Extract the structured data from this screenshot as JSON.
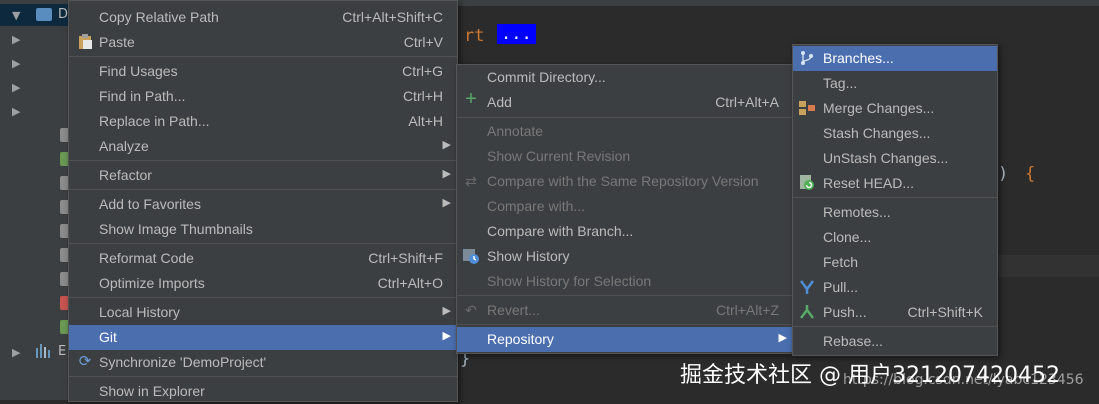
{
  "tree": {
    "root_label": "D",
    "bottom_label": "E"
  },
  "editor": {
    "keyword": "rt",
    "highlight": "...",
    "paren": ")",
    "brace": "{",
    "close_brace": "}"
  },
  "menu1": {
    "items": [
      {
        "label": "Copy Relative Path",
        "shortcut": "Ctrl+Alt+Shift+C"
      },
      {
        "label": "Paste",
        "shortcut": "Ctrl+V",
        "icon": "clipboard-icon"
      },
      {
        "label": "Find Usages",
        "shortcut": "Ctrl+G"
      },
      {
        "label": "Find in Path...",
        "shortcut": "Ctrl+H"
      },
      {
        "label": "Replace in Path...",
        "shortcut": "Alt+H"
      },
      {
        "label": "Analyze",
        "submenu": true
      },
      {
        "label": "Refactor",
        "submenu": true
      },
      {
        "label": "Add to Favorites",
        "submenu": true
      },
      {
        "label": "Show Image Thumbnails"
      },
      {
        "label": "Reformat Code",
        "shortcut": "Ctrl+Shift+F"
      },
      {
        "label": "Optimize Imports",
        "shortcut": "Ctrl+Alt+O"
      },
      {
        "label": "Local History",
        "submenu": true
      },
      {
        "label": "Git",
        "submenu": true,
        "highlighted": true
      },
      {
        "label": "Synchronize 'DemoProject'",
        "icon": "sync-icon"
      },
      {
        "label": "Show in Explorer"
      }
    ]
  },
  "menu2": {
    "items": [
      {
        "label": "Commit Directory..."
      },
      {
        "label": "Add",
        "shortcut": "Ctrl+Alt+A",
        "icon": "plus-icon"
      },
      {
        "label": "Annotate",
        "disabled": true
      },
      {
        "label": "Show Current Revision",
        "disabled": true
      },
      {
        "label": "Compare with the Same Repository Version",
        "disabled": true,
        "icon": "compare-icon"
      },
      {
        "label": "Compare with...",
        "disabled": true
      },
      {
        "label": "Compare with Branch..."
      },
      {
        "label": "Show History",
        "icon": "history-icon"
      },
      {
        "label": "Show History for Selection",
        "disabled": true
      },
      {
        "label": "Revert...",
        "shortcut": "Ctrl+Alt+Z",
        "disabled": true,
        "icon": "revert-icon"
      },
      {
        "label": "Repository",
        "submenu": true,
        "highlighted": true
      }
    ]
  },
  "menu3": {
    "items": [
      {
        "label": "Branches...",
        "highlighted": true,
        "icon": "branch-icon"
      },
      {
        "label": "Tag..."
      },
      {
        "label": "Merge Changes...",
        "icon": "merge-icon"
      },
      {
        "label": "Stash Changes..."
      },
      {
        "label": "UnStash Changes..."
      },
      {
        "label": "Reset HEAD...",
        "icon": "reset-icon"
      },
      {
        "label": "Remotes..."
      },
      {
        "label": "Clone..."
      },
      {
        "label": "Fetch"
      },
      {
        "label": "Pull...",
        "icon": "pull-icon"
      },
      {
        "label": "Push...",
        "shortcut": "Ctrl+Shift+K",
        "icon": "push-icon"
      },
      {
        "label": "Rebase..."
      }
    ]
  },
  "watermark": {
    "main": "掘金技术社区 @ 用户321207420452",
    "url": "https://blog.csdn.net/lyabc123456"
  },
  "colors": {
    "highlight": "#4b6eaf",
    "menu_bg": "#3c3f41",
    "editor_bg": "#2b2b2b"
  }
}
